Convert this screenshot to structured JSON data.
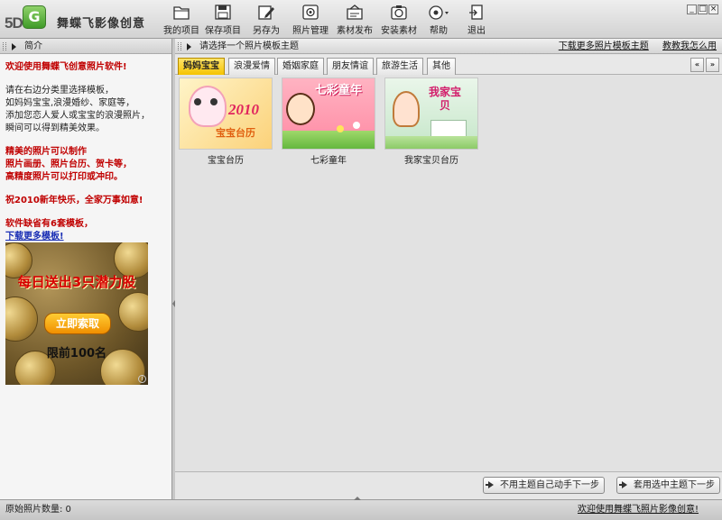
{
  "app": {
    "logo_prefix": "5D",
    "name": "舞蝶飞影像创意"
  },
  "toolbar": [
    {
      "label": "我的项目",
      "icon": "folder-icon"
    },
    {
      "label": "保存项目",
      "icon": "floppy-disk-icon"
    },
    {
      "label": "另存为",
      "icon": "save-as-icon"
    },
    {
      "label": "照片管理",
      "icon": "photo-manager-icon"
    },
    {
      "label": "素材发布",
      "icon": "publish-material-icon"
    },
    {
      "label": "安装素材",
      "icon": "install-material-icon"
    },
    {
      "label": "帮助",
      "icon": "help-icon"
    },
    {
      "label": "退出",
      "icon": "exit-icon"
    }
  ],
  "window_controls": [
    "_",
    "□",
    "×"
  ],
  "left_panel": {
    "title": "简介",
    "welcome": "欢迎使用舞蝶飞创意照片软件!",
    "instructions": [
      "请在右边分类里选择模板，",
      "如妈妈宝宝,浪漫婚纱、家庭等，",
      "添加您恋人爱人或宝宝的浪漫照片，",
      "瞬间可以得到精美效果。"
    ],
    "features": [
      "精美的照片可以制作",
      "照片画册、照片台历、贺卡等，",
      "高精度照片可以打印或冲印。"
    ],
    "greeting": "祝2010新年快乐，全家万事如意!",
    "default_templates": "软件缺省有6套模板，",
    "more_link": "下载更多模板!",
    "ad": {
      "line1": "每日送出3只潜力股",
      "button": "立即索取",
      "line3": "限前100名",
      "info": "i"
    }
  },
  "main": {
    "header_prompt": "请选择一个照片模板主题",
    "download_link": "下载更多照片模板主题",
    "guide_link": "教教我怎么用",
    "tabs": [
      "妈妈宝宝",
      "浪漫爱情",
      "婚姻家庭",
      "朋友情谊",
      "旅游生活",
      "其他"
    ],
    "active_tab": 0,
    "scroll_left": "«",
    "scroll_right": "»",
    "templates": [
      {
        "caption": "宝宝台历",
        "overlay": "2010",
        "overlay2": "宝宝台历"
      },
      {
        "caption": "七彩童年",
        "overlay": "七彩童年"
      },
      {
        "caption": "我家宝贝台历",
        "overlay": "我家宝贝"
      }
    ],
    "btn_manual": "不用主题自己动手下一步",
    "btn_use_theme": "套用选中主题下一步"
  },
  "status": {
    "photo_count": "原始照片数量: 0",
    "welcome_link": "欢迎使用舞蝶飞照片影像创意!"
  },
  "colors": {
    "accent_tab": "#f5c400",
    "red_text": "#c00000",
    "link_blue": "#1a2fb5"
  }
}
